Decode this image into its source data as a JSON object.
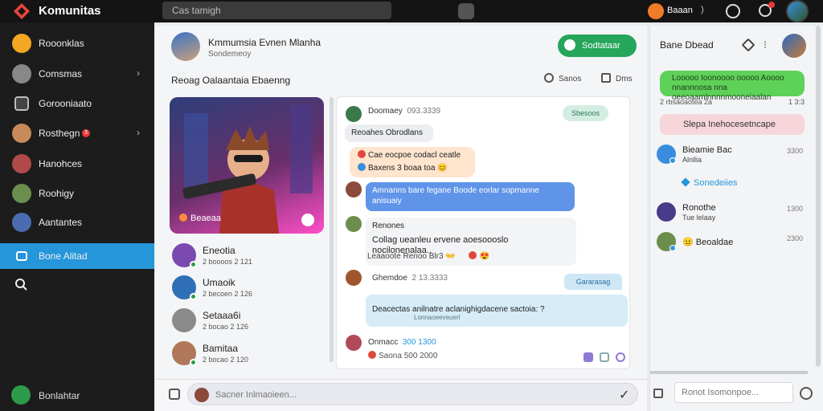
{
  "app": {
    "title": "Komunitas"
  },
  "topbar": {
    "search_placeholder": "Cas tamigh",
    "user_name": "Baaan",
    "user_chevron": ")"
  },
  "sidebar": {
    "items": [
      {
        "label": "Rooonklas",
        "color": "#f5a623",
        "chevron": ""
      },
      {
        "label": "Comsmas",
        "color": "#888888",
        "chevron": "›"
      },
      {
        "label": "Gorooniaato",
        "color": "#666666",
        "chevron": ""
      },
      {
        "label": "Rosthegn",
        "color": "#c78b5b",
        "chevron": "›",
        "badge": "3"
      },
      {
        "label": "Hanohces",
        "color": "#b04a4a",
        "chevron": ""
      },
      {
        "label": "Roohigy",
        "color": "#6b8e4e",
        "chevron": ""
      },
      {
        "label": "Aantantes",
        "color": "#4a6bb0",
        "chevron": ""
      },
      {
        "label": "Bone Alitad",
        "color": "#2596d9",
        "chevron": "",
        "active": true
      }
    ],
    "bottom_label": "Bonlahtar"
  },
  "chat": {
    "title": "Kmmumsia Evnen Mlanha",
    "subtitle": "Sondemeoy",
    "join_label": "Sodtataar",
    "section_title": "Reoag Oalaantaia  Ebaenng",
    "search_tab": "Sanos",
    "clear_tab": "Dms"
  },
  "members": {
    "hero_caption": "Beaeaa",
    "list": [
      {
        "name": "Eneotia",
        "meta": "2 boooos 2 121",
        "color": "#7a4ab0"
      },
      {
        "name": "Umaoik",
        "meta": "2 becoen 2 126",
        "color": "#2f6fb5"
      },
      {
        "name": "Setaaa6i",
        "meta": "2 bocao 2 126",
        "color": "#8a8a8a"
      },
      {
        "name": "Bamitaa",
        "meta": "2 bocao 2 120",
        "color": "#b0775a"
      }
    ]
  },
  "messages": {
    "hidden_tag": "Sbesoos",
    "sticker_tag": "Gararasag",
    "list": [
      {
        "author": "Doomaey",
        "time": "093.3339"
      },
      {
        "text": "Reoahes Obrodlans"
      },
      {
        "text": "Cae eocpoe codacl ceatle"
      },
      {
        "text": "Baxens  3 boaa toa"
      },
      {
        "text": "Amnanns bare fegane Boode eorlar sopmanne anisuaiy"
      },
      {
        "author": "Renones",
        "text": "Collag ueanleu ervene aoesoooslo nocilonenalaa.."
      },
      {
        "text": "Leaaoote Renoo Blr3"
      },
      {
        "author": "Ghemdoe",
        "time": "2 13.3333"
      },
      {
        "text": "Deacectas anilnatre aclanighigdacene sactoia: ?"
      },
      {
        "text": "Lonnaoeeveuerl"
      },
      {
        "author": "Onmacc",
        "time": "300 1300"
      },
      {
        "text": "Saona 500 2000"
      }
    ]
  },
  "composer": {
    "placeholder": "Sacner Inlmaoieen..."
  },
  "right_panel": {
    "title": "Bane Dbead",
    "green_msg": "Looooo Ioonoooo ooooo Aoooo nnannnosa nna oeeoaamlnnnnmooneiaalan",
    "green_meta_left": "2 rbsaoaotea 2a",
    "green_meta_right": "1 3:3",
    "pink_msg": "Slepa Inehocesetncape",
    "items": [
      {
        "name": "Bieamie Bac",
        "sub": "Alnllia",
        "time": "3300",
        "color": "#3a8dde"
      },
      {
        "name": "Ronothe",
        "sub": "Tue lelaay",
        "time": "1300",
        "color": "#4a3a8a"
      },
      {
        "name": "Beoaldae",
        "sub": "",
        "time": "2300",
        "color": "#6b8e4e"
      }
    ],
    "section_label": "Sonedeiies",
    "reply_placeholder": "Ronot Isomonpoe..."
  },
  "colors": {
    "accent": "#2596d9",
    "join_green": "#25a65a",
    "sidebar_bg": "#1c1c1c",
    "topbar_bg": "#141414"
  }
}
